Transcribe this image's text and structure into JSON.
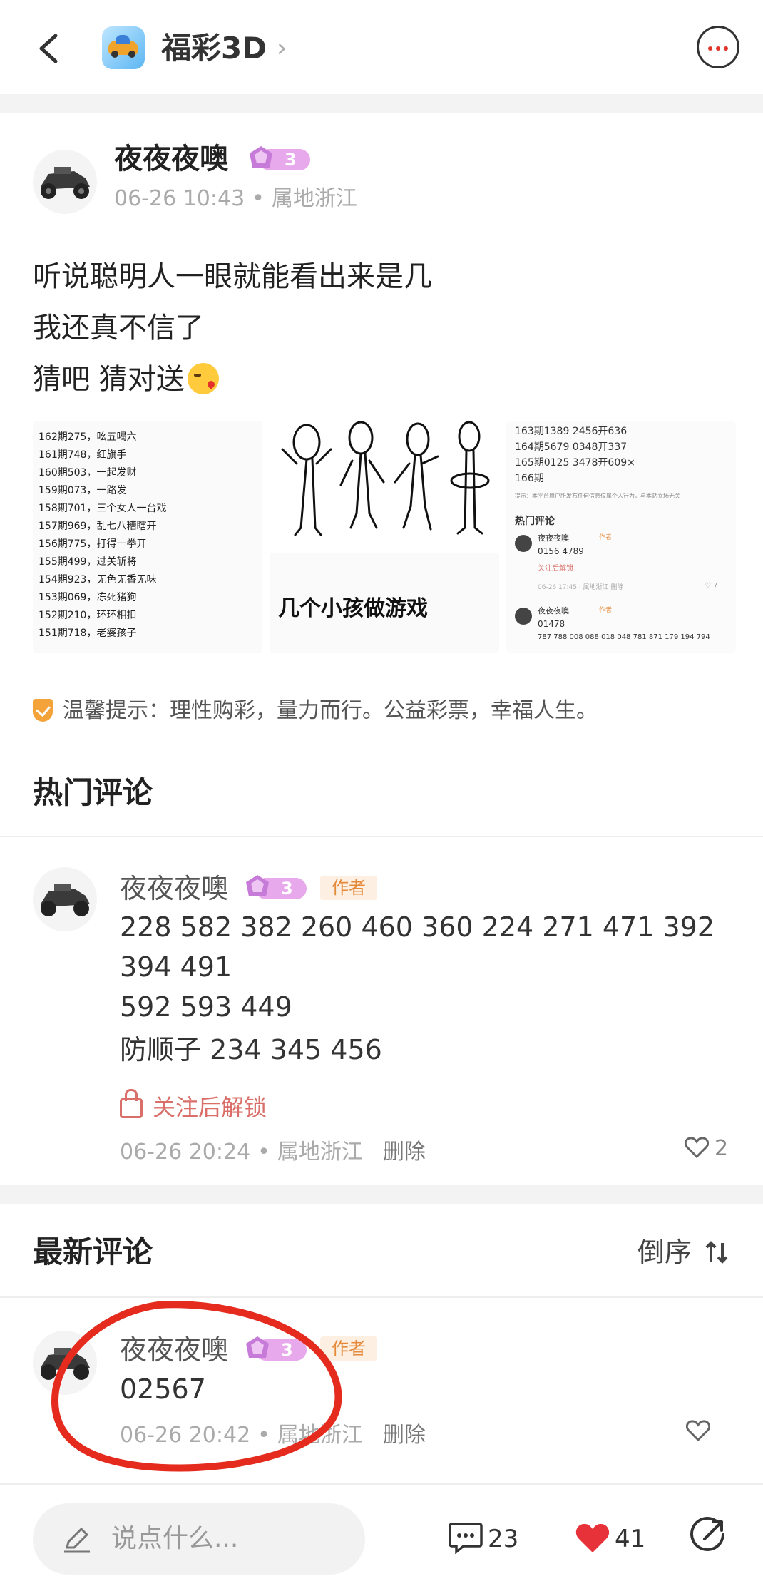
{
  "header": {
    "title": "福彩3D",
    "chevron": "›",
    "back_icon": "chevron-left-icon",
    "more_icon": "more-horizontal-icon"
  },
  "post": {
    "author": "夜夜夜噢",
    "level": "3",
    "time": "06-26 10:43",
    "location": "属地浙江",
    "text_lines": [
      "听说聪明人一眼就能看出来是几",
      "我还真不信了",
      "猜吧 猜对送"
    ],
    "images": {
      "left_lines": [
        "162期275，吆五喝六",
        "161期748，红旗手",
        "160期503，一起发财",
        "159期073，一路发",
        "158期701，三个女人一台戏",
        "157期969，乱七八糟瞎开",
        "156期775，打得一拳开",
        "155期499，过关斩将",
        "154期923，无色无香无味",
        "153期069，冻死猪狗",
        "152期210，环环相扣",
        "151期718，老婆孩子"
      ],
      "middle_caption": "几个小孩做游戏",
      "right_lines": [
        "163期1389  2456开636",
        "164期5679  0348开337",
        "165期0125  3478开609×",
        "166期"
      ],
      "right_hint": "提示：本平台用户所发布任何信息仅属个人行为，与本站立场无关",
      "right_hot": "热门评论",
      "right_c1_name": "夜夜夜噢",
      "right_c1_text": "0156 4789",
      "right_c1_lock": "关注后解锁",
      "right_c1_meta": "06-26 17:45 · 属地浙江  删除",
      "right_c1_like": "♡ 7",
      "right_c2_name": "夜夜夜噢",
      "right_c2_text": "01478",
      "right_c2_nums": "787 788 008 088 018 048 781 871 179 194 794",
      "right_author": "作者"
    }
  },
  "tip": "温馨提示：理性购彩，量力而行。公益彩票，幸福人生。",
  "hot_comments": {
    "title": "热门评论",
    "items": [
      {
        "author": "夜夜夜噢",
        "level": "3",
        "tag": "作者",
        "lines": [
          "228 582 382 260 460 360 224  271  471 392",
          "394 491",
          "592 593 449",
          "防顺子 234 345 456"
        ],
        "lock_text": "关注后解锁",
        "time": "06-26 20:24",
        "location": "属地浙江",
        "delete": "删除",
        "likes": "2"
      }
    ]
  },
  "latest_comments": {
    "title": "最新评论",
    "sort_label": "倒序",
    "items": [
      {
        "author": "夜夜夜噢",
        "level": "3",
        "tag": "作者",
        "text": "02567",
        "time": "06-26 20:42",
        "location": "属地浙江",
        "delete": "删除"
      }
    ]
  },
  "bottom_bar": {
    "placeholder": "说点什么...",
    "comments": "23",
    "likes": "41",
    "like_color": "#e8323a"
  },
  "colors": {
    "accent_orange": "#f4a23a",
    "lock_red": "#d96f68",
    "annotation_red": "#e52a1e"
  }
}
